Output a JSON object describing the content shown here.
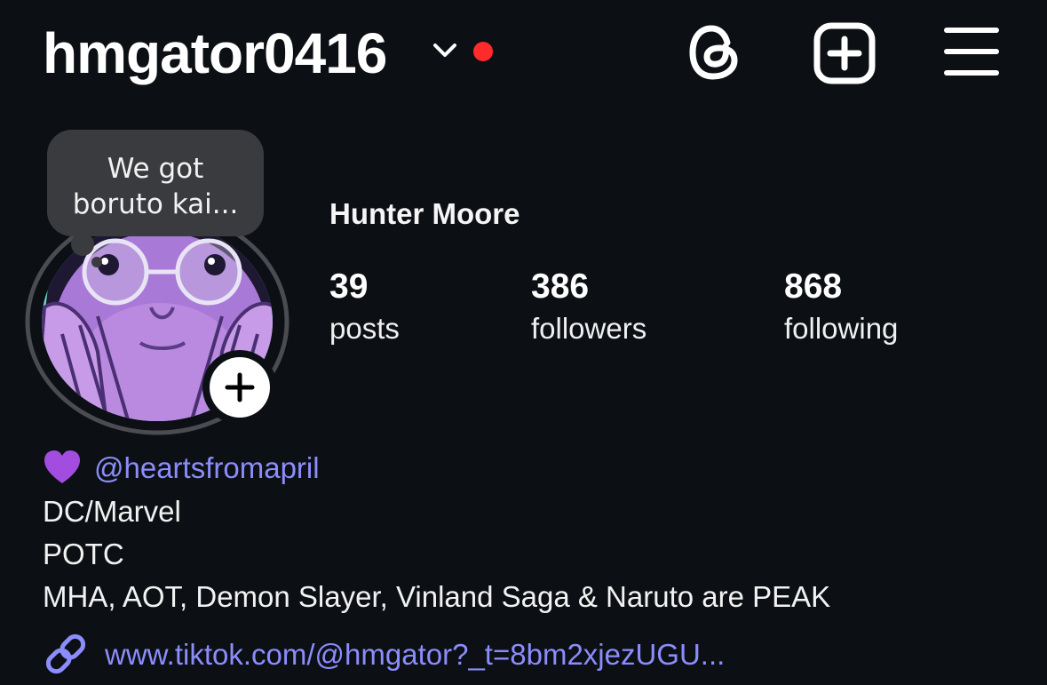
{
  "header": {
    "username": "hmgator0416",
    "chevron_icon": "chevron-down-icon",
    "notification_dot_color": "#ff2a2a",
    "actions": [
      "threads-icon",
      "new-post-icon",
      "menu-icon"
    ]
  },
  "profile": {
    "note": "We got boruto kai...",
    "display_name": "Hunter Moore",
    "stats": {
      "posts_count": "39",
      "posts_label": "posts",
      "followers_count": "386",
      "followers_label": "followers",
      "following_count": "868",
      "following_label": "following"
    }
  },
  "bio": {
    "heart_icon": "purple-heart-icon",
    "mention": "@heartsfromapril",
    "lines": [
      "DC/Marvel",
      "POTC",
      "MHA, AOT, Demon Slayer, Vinland Saga & Naruto are PEAK"
    ],
    "link_icon": "link-icon",
    "link": "www.tiktok.com/@hmgator?_t=8bm2xjezUGU..."
  },
  "colors": {
    "background": "#0c0f14",
    "link": "#8b8dfb",
    "note_bubble": "#3a3b3e"
  }
}
